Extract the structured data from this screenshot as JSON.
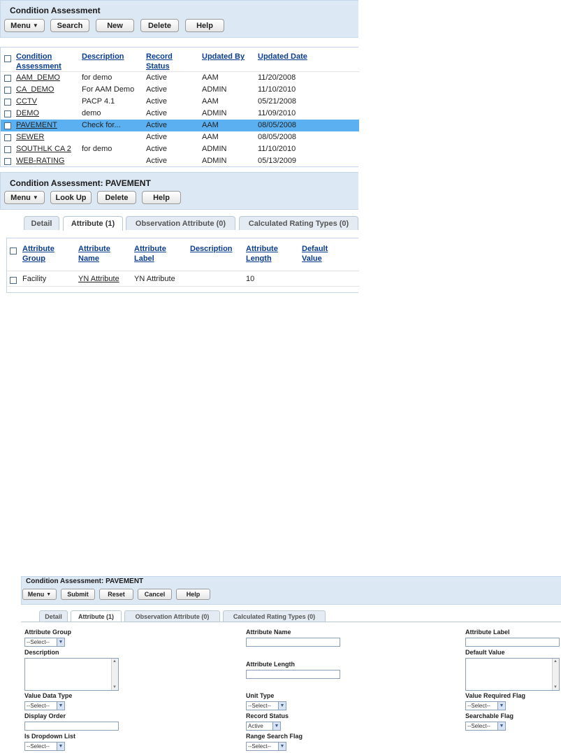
{
  "top_panel": {
    "title": "Condition Assessment",
    "buttons": {
      "menu": "Menu",
      "search": "Search",
      "new": "New",
      "delete": "Delete",
      "help": "Help"
    }
  },
  "list_grid": {
    "headers": {
      "ca_line1": "Condition",
      "ca_line2": "Assessment",
      "description": "Description",
      "rs_line1": "Record",
      "rs_line2": "Status",
      "updated_by": "Updated By",
      "updated_date": "Updated Date"
    },
    "rows": [
      {
        "name": "AAM_DEMO",
        "description": "for demo",
        "status": "Active",
        "updated_by": "AAM",
        "updated_date": "11/20/2008"
      },
      {
        "name": "CA_DEMO",
        "description": "For AAM Demo",
        "status": "Active",
        "updated_by": "ADMIN",
        "updated_date": "11/10/2010"
      },
      {
        "name": "CCTV",
        "description": "PACP 4.1",
        "status": "Active",
        "updated_by": "AAM",
        "updated_date": "05/21/2008"
      },
      {
        "name": "DEMO",
        "description": "demo",
        "status": "Active",
        "updated_by": "ADMIN",
        "updated_date": "11/09/2010"
      },
      {
        "name": "PAVEMENT",
        "description": "Check for...",
        "status": "Active",
        "updated_by": "AAM",
        "updated_date": "08/05/2008"
      },
      {
        "name": "SEWER",
        "description": "",
        "status": "Active",
        "updated_by": "AAM",
        "updated_date": "08/05/2008"
      },
      {
        "name": "SOUTHLK CA 2",
        "description": "for demo",
        "status": "Active",
        "updated_by": "ADMIN",
        "updated_date": "11/10/2010"
      },
      {
        "name": "WEB-RATING",
        "description": "",
        "status": "Active",
        "updated_by": "ADMIN",
        "updated_date": "05/13/2009"
      }
    ],
    "selected_index": 4
  },
  "detail_panel": {
    "title": "Condition Assessment: PAVEMENT",
    "buttons": {
      "menu": "Menu",
      "lookup": "Look Up",
      "delete": "Delete",
      "help": "Help"
    },
    "tabs": {
      "detail": "Detail",
      "attribute": "Attribute (1)",
      "observation": "Observation Attribute (0)",
      "calculated": "Calculated Rating Types (0)"
    },
    "active_tab": "attribute"
  },
  "attr_grid": {
    "headers": {
      "group_1": "Attribute",
      "group_2": "Group",
      "name_1": "Attribute",
      "name_2": "Name",
      "label_1": "Attribute",
      "label_2": "Label",
      "description": "Description",
      "length_1": "Attribute",
      "length_2": "Length",
      "default_1": "Default",
      "default_2": "Value"
    },
    "row": {
      "group": "Facility",
      "name": "YN Attribute",
      "label": "YN Attribute",
      "description": "",
      "length": "10",
      "default": ""
    }
  },
  "edit_panel": {
    "title": "Condition Assessment: PAVEMENT",
    "buttons": {
      "menu": "Menu",
      "submit": "Submit",
      "reset": "Reset",
      "cancel": "Cancel",
      "help": "Help"
    },
    "tabs": {
      "detail": "Detail",
      "attribute": "Attribute (1)",
      "observation": "Observation Attribute (0)",
      "calculated": "Calculated Rating Types (0)"
    },
    "form": {
      "attribute_group_label": "Attribute Group",
      "attribute_group_value": "--Select--",
      "attribute_name_label": "Attribute Name",
      "attribute_name_value": "",
      "attribute_label_label": "Attribute Label",
      "attribute_label_value": "",
      "description_label": "Description",
      "description_value": "",
      "attribute_length_label": "Attribute Length",
      "attribute_length_value": "",
      "default_value_label": "Default Value",
      "default_value_value": "",
      "value_data_type_label": "Value Data Type",
      "value_data_type_value": "--Select--",
      "unit_type_label": "Unit Type",
      "unit_type_value": "--Select--",
      "value_required_flag_label": "Value Required Flag",
      "value_required_flag_value": "--Select--",
      "display_order_label": "Display Order",
      "display_order_value": "",
      "record_status_label": "Record Status",
      "record_status_value": "Active",
      "searchable_flag_label": "Searchable Flag",
      "searchable_flag_value": "--Select--",
      "is_dropdown_list_label": "Is Dropdown List",
      "is_dropdown_list_value": "--Select--",
      "range_search_flag_label": "Range Search Flag",
      "range_search_flag_value": "--Select--"
    }
  },
  "icons": {
    "menu_arrow": "dropdown-arrow-icon",
    "select_arrow": "chevron-down-icon",
    "scroll_up": "scroll-up-icon",
    "scroll_down": "scroll-down-icon"
  },
  "colors": {
    "panel_bg": "#dde8f5",
    "selected_row": "#5ab0f0",
    "link": "#0a3d91"
  }
}
